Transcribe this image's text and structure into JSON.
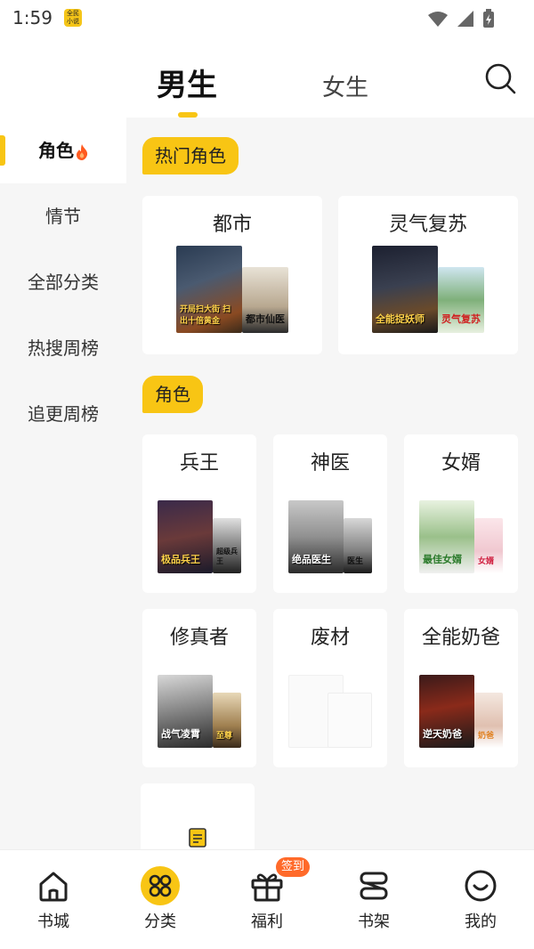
{
  "status_bar": {
    "time": "1:59",
    "app_badge": "全民\n小说"
  },
  "top_tabs": {
    "male": "男生",
    "female": "女生",
    "active": "男生",
    "accent": "#F8C514"
  },
  "sidebar": {
    "items": [
      {
        "label": "角色",
        "active": true,
        "icon": "fire-icon"
      },
      {
        "label": "情节"
      },
      {
        "label": "全部分类"
      },
      {
        "label": "热搜周榜"
      },
      {
        "label": "追更周榜"
      }
    ]
  },
  "sections": {
    "hot_roles": {
      "label": "热门角色",
      "cards": [
        {
          "title": "都市",
          "cover_a_text": "开局扫大街 扫出十倍黄金",
          "cover_b_text": "都市仙医"
        },
        {
          "title": "灵气复苏",
          "cover_a_text": "全能捉妖师",
          "cover_b_text": "灵气复苏"
        }
      ]
    },
    "roles": {
      "label": "角色",
      "cards": [
        {
          "title": "兵王",
          "cover_a_text": "极品兵王",
          "cover_b_text": "超级兵王"
        },
        {
          "title": "神医",
          "cover_a_text": "绝品医生",
          "cover_b_text": "医生"
        },
        {
          "title": "女婿",
          "cover_a_text": "最佳女婿",
          "cover_b_text": "女婿"
        },
        {
          "title": "修真者",
          "cover_a_text": "战气凌霄",
          "cover_b_text": "至尊"
        },
        {
          "title": "废材",
          "cover_a_text": "",
          "cover_b_text": ""
        },
        {
          "title": "全能奶爸",
          "cover_a_text": "逆天奶爸",
          "cover_b_text": "奶爸"
        }
      ]
    }
  },
  "bottom_nav": {
    "items": [
      {
        "label": "书城",
        "icon": "home-icon"
      },
      {
        "label": "分类",
        "icon": "category-icon",
        "active": true
      },
      {
        "label": "福利",
        "icon": "gift-icon",
        "badge": "签到"
      },
      {
        "label": "书架",
        "icon": "bookshelf-icon"
      },
      {
        "label": "我的",
        "icon": "profile-icon"
      }
    ]
  }
}
